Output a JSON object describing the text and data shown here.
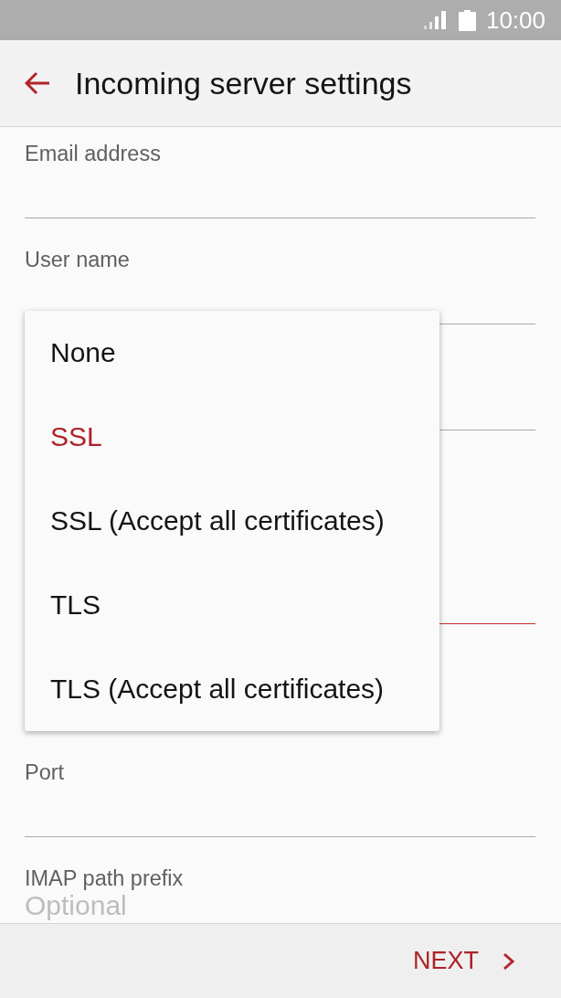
{
  "status_bar": {
    "time": "10:00"
  },
  "header": {
    "title": "Incoming server settings"
  },
  "fields": [
    {
      "kind": "text",
      "label": "Email address",
      "focused": false
    },
    {
      "kind": "text",
      "label": "User name",
      "focused": false
    },
    {
      "kind": "text",
      "focused": false
    },
    {
      "kind": "dropdown",
      "focused": true
    },
    {
      "kind": "text",
      "label": "Port",
      "focused": false
    },
    {
      "kind": "text",
      "label": "IMAP path prefix",
      "placeholder": "Optional"
    }
  ],
  "menu": {
    "items": [
      {
        "label": "None",
        "selected": false
      },
      {
        "label": "SSL",
        "selected": true
      },
      {
        "label": "SSL (Accept all certificates)",
        "selected": false
      },
      {
        "label": "TLS",
        "selected": false
      },
      {
        "label": "TLS (Accept all certificates)",
        "selected": false
      }
    ]
  },
  "footer": {
    "next_button": "NEXT"
  }
}
